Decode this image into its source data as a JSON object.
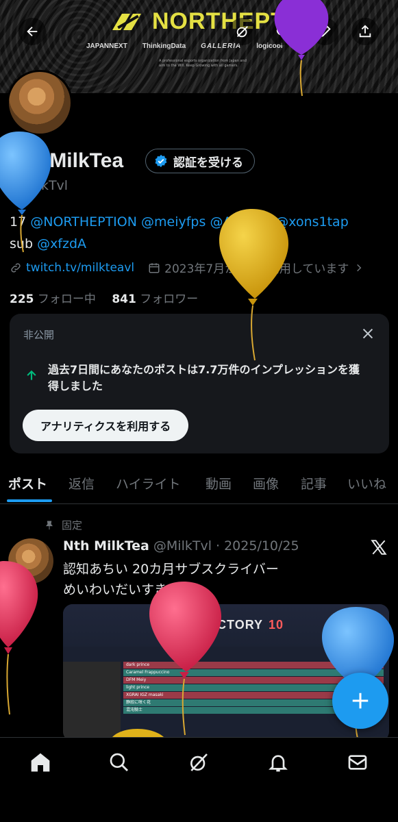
{
  "banner": {
    "brand_name": "NORTHEPTION",
    "sponsors": [
      "JAPANNEXT",
      "ThinkingData",
      "GALLERIA",
      "logicool"
    ],
    "caption": "A professional esports organization from Japan and aim to the Will. Keep Growing with all gamers."
  },
  "profile": {
    "display_name": "Nth MilkTea",
    "verify_label": "認証を受ける",
    "handle": "@MilkTvl",
    "bio_prefix": "17",
    "bio_mentions": [
      "@NORTHEPTION",
      "@meiyfps",
      "@Aaceful",
      "@xons1tap"
    ],
    "bio_sub": "sub",
    "bio_sub_mention": "@xfzdA",
    "link": "twitch.tv/milkteavl",
    "joined": "2023年7月からXを利用しています",
    "following_count": "225",
    "following_label": "フォロー中",
    "followers_count": "841",
    "followers_label": "フォロワー"
  },
  "private_card": {
    "label": "非公開",
    "message": "過去7日間にあなたのポストは7.7万件のインプレッションを獲得しました",
    "button": "アナリティクスを利用する"
  },
  "tabs": [
    "ポスト",
    "返信",
    "ハイライト",
    "動画",
    "画像",
    "記事",
    "いいね"
  ],
  "post": {
    "pinned_label": "固定",
    "author": "Nth MilkTea",
    "handle_date": "@MilkTvl · 2025/10/25",
    "text_line1": "認知あちい 20カ月サブスクライバー",
    "text_line2": "めいわいだいすき",
    "image": {
      "score_left": "13",
      "result": "VICTORY",
      "score_right": "10",
      "rows": [
        "dark prince",
        "Caramel Frappuccino",
        "DFM Meiy",
        "light prince",
        "XGRAI IGZ masaki",
        "静寂に咲く花",
        "混沌騎士"
      ]
    }
  },
  "colors": {
    "accent": "#1d9bf0",
    "brand_yellow": "#e4e043",
    "balloon_blue": "#2f8fe6",
    "balloon_yellow": "#e0b21a",
    "balloon_pink": "#e0305a",
    "balloon_purple": "#8a2fd6"
  },
  "icons": [
    "back-arrow-icon",
    "grok-icon",
    "search-icon",
    "edit-icon",
    "share-icon",
    "verified-badge-icon",
    "link-icon",
    "calendar-icon",
    "chevron-right-icon",
    "close-icon",
    "trend-up-icon",
    "pin-icon",
    "x-logo-icon",
    "plus-icon",
    "home-icon",
    "search-icon",
    "grok-icon",
    "bell-icon",
    "mail-icon"
  ]
}
